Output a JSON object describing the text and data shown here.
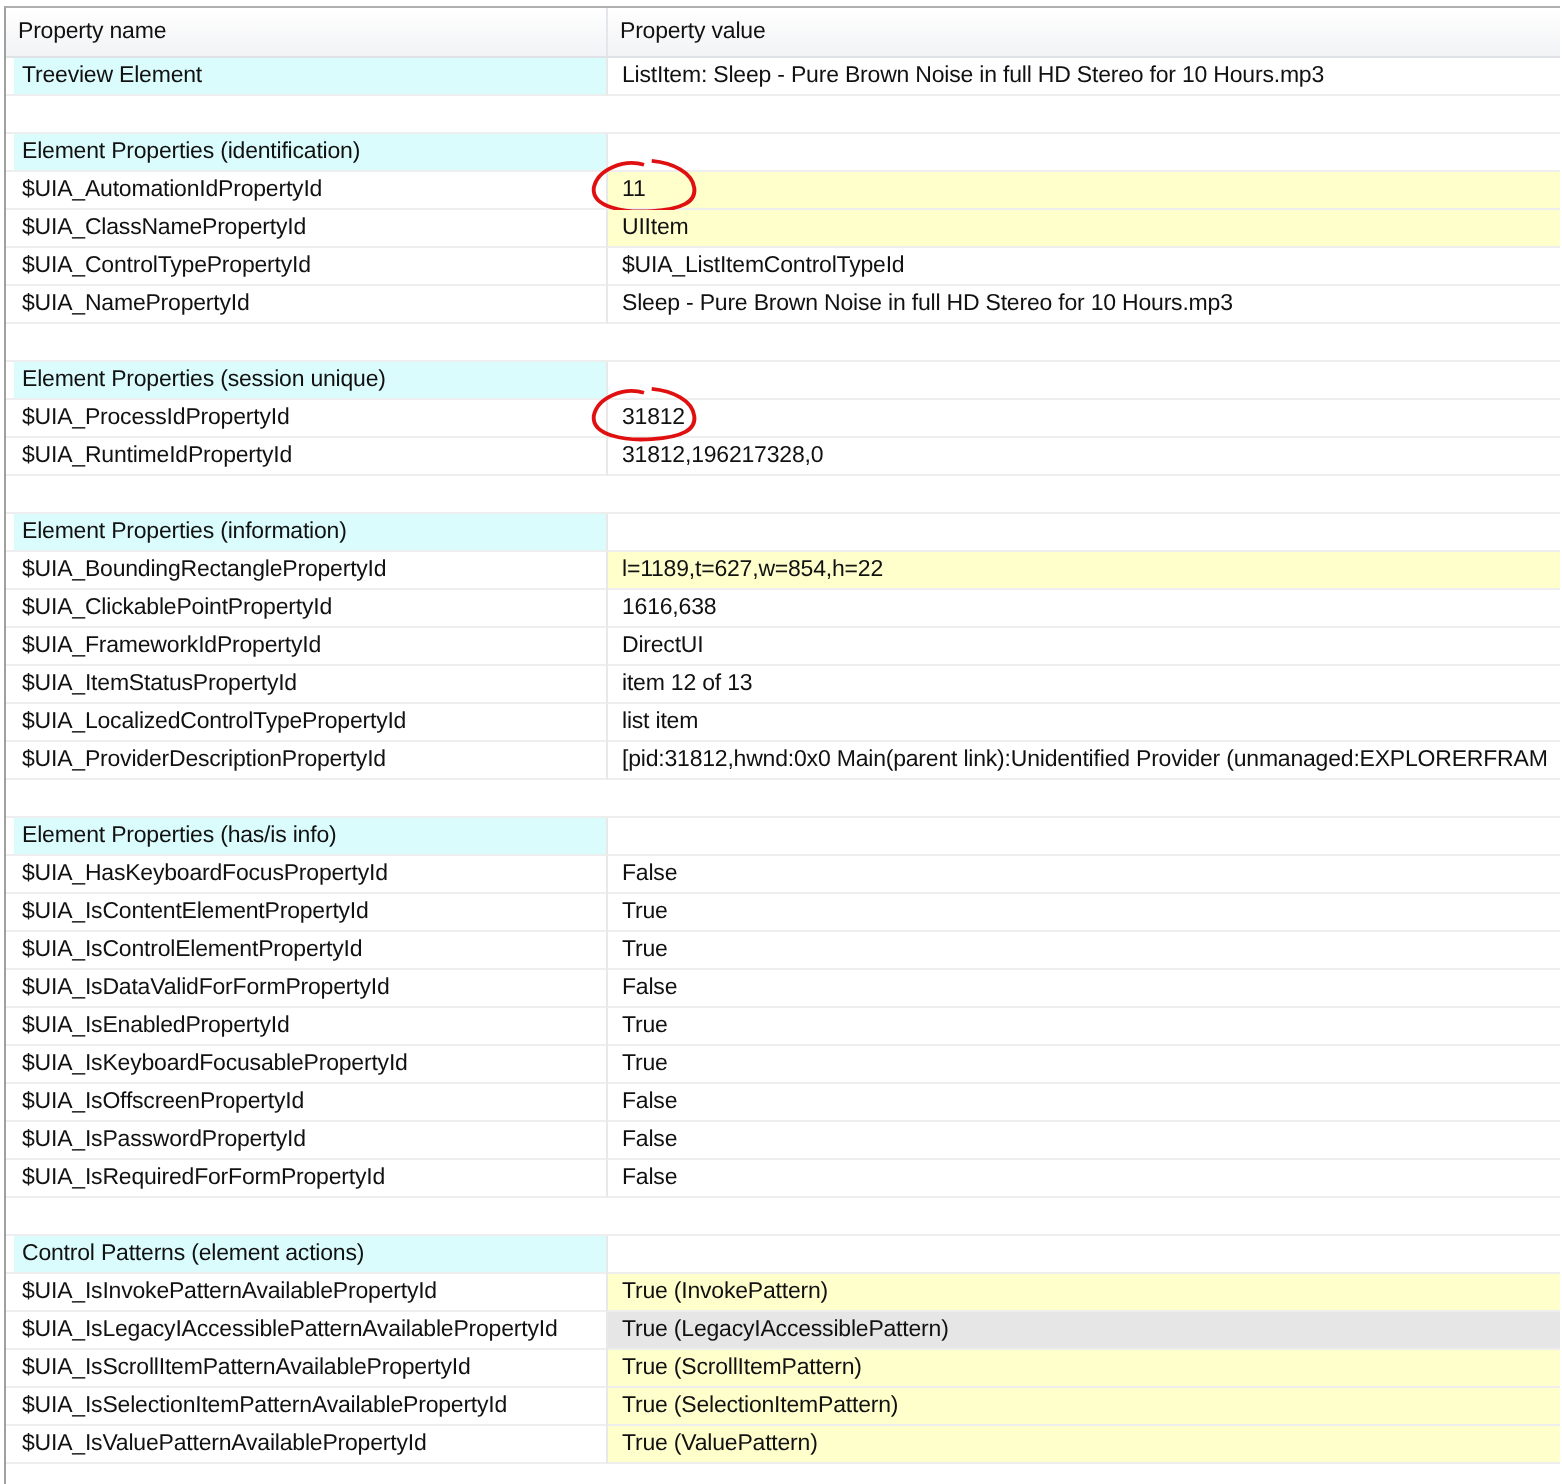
{
  "columns": [
    "Property name",
    "Property value"
  ],
  "rows": [
    {
      "kind": "group",
      "name": "Treeview Element",
      "value": "ListItem: Sleep - Pure Brown Noise in full HD Stereo for 10 Hours.mp3"
    },
    {
      "kind": "blank"
    },
    {
      "kind": "group",
      "name": "Element Properties (identification)"
    },
    {
      "kind": "item",
      "name": "$UIA_AutomationIdPropertyId",
      "value": "11",
      "highlighted": true,
      "selected": false,
      "circled": true
    },
    {
      "kind": "item",
      "name": "$UIA_ClassNamePropertyId",
      "value": "UIItem",
      "highlighted": true,
      "selected": false,
      "circled": false
    },
    {
      "kind": "item",
      "name": "$UIA_ControlTypePropertyId",
      "value": "$UIA_ListItemControlTypeId",
      "highlighted": false,
      "selected": false,
      "circled": false
    },
    {
      "kind": "item",
      "name": "$UIA_NamePropertyId",
      "value": "Sleep - Pure Brown Noise in full HD Stereo for 10 Hours.mp3",
      "highlighted": false,
      "selected": false,
      "circled": false
    },
    {
      "kind": "blank"
    },
    {
      "kind": "group",
      "name": "Element Properties (session unique)"
    },
    {
      "kind": "item",
      "name": "$UIA_ProcessIdPropertyId",
      "value": "31812",
      "highlighted": false,
      "selected": false,
      "circled": true
    },
    {
      "kind": "item",
      "name": "$UIA_RuntimeIdPropertyId",
      "value": "31812,196217328,0",
      "highlighted": false,
      "selected": false,
      "circled": false
    },
    {
      "kind": "blank"
    },
    {
      "kind": "group",
      "name": "Element Properties (information)"
    },
    {
      "kind": "item",
      "name": "$UIA_BoundingRectanglePropertyId",
      "value": "l=1189,t=627,w=854,h=22",
      "highlighted": true,
      "selected": false,
      "circled": false
    },
    {
      "kind": "item",
      "name": "$UIA_ClickablePointPropertyId",
      "value": "1616,638",
      "highlighted": false,
      "selected": false,
      "circled": false
    },
    {
      "kind": "item",
      "name": "$UIA_FrameworkIdPropertyId",
      "value": "DirectUI",
      "highlighted": false,
      "selected": false,
      "circled": false
    },
    {
      "kind": "item",
      "name": "$UIA_ItemStatusPropertyId",
      "value": "item 12 of 13",
      "highlighted": false,
      "selected": false,
      "circled": false
    },
    {
      "kind": "item",
      "name": "$UIA_LocalizedControlTypePropertyId",
      "value": "list item",
      "highlighted": false,
      "selected": false,
      "circled": false
    },
    {
      "kind": "item",
      "name": "$UIA_ProviderDescriptionPropertyId",
      "value": "[pid:31812,hwnd:0x0 Main(parent link):Unidentified Provider (unmanaged:EXPLORERFRAM",
      "highlighted": false,
      "selected": false,
      "circled": false
    },
    {
      "kind": "blank"
    },
    {
      "kind": "group",
      "name": "Element Properties (has/is info)"
    },
    {
      "kind": "item",
      "name": "$UIA_HasKeyboardFocusPropertyId",
      "value": "False",
      "highlighted": false,
      "selected": false,
      "circled": false
    },
    {
      "kind": "item",
      "name": "$UIA_IsContentElementPropertyId",
      "value": "True",
      "highlighted": false,
      "selected": false,
      "circled": false
    },
    {
      "kind": "item",
      "name": "$UIA_IsControlElementPropertyId",
      "value": "True",
      "highlighted": false,
      "selected": false,
      "circled": false
    },
    {
      "kind": "item",
      "name": "$UIA_IsDataValidForFormPropertyId",
      "value": "False",
      "highlighted": false,
      "selected": false,
      "circled": false
    },
    {
      "kind": "item",
      "name": "$UIA_IsEnabledPropertyId",
      "value": "True",
      "highlighted": false,
      "selected": false,
      "circled": false
    },
    {
      "kind": "item",
      "name": "$UIA_IsKeyboardFocusablePropertyId",
      "value": "True",
      "highlighted": false,
      "selected": false,
      "circled": false
    },
    {
      "kind": "item",
      "name": "$UIA_IsOffscreenPropertyId",
      "value": "False",
      "highlighted": false,
      "selected": false,
      "circled": false
    },
    {
      "kind": "item",
      "name": "$UIA_IsPasswordPropertyId",
      "value": "False",
      "highlighted": false,
      "selected": false,
      "circled": false
    },
    {
      "kind": "item",
      "name": "$UIA_IsRequiredForFormPropertyId",
      "value": "False",
      "highlighted": false,
      "selected": false,
      "circled": false
    },
    {
      "kind": "blank"
    },
    {
      "kind": "group",
      "name": "Control Patterns (element actions)"
    },
    {
      "kind": "item",
      "name": "$UIA_IsInvokePatternAvailablePropertyId",
      "value": "True (InvokePattern)",
      "highlighted": true,
      "selected": false,
      "circled": false
    },
    {
      "kind": "item",
      "name": "$UIA_IsLegacyIAccessiblePatternAvailablePropertyId",
      "value": "True (LegacyIAccessiblePattern)",
      "selected": true,
      "circled": false
    },
    {
      "kind": "item",
      "name": "$UIA_IsScrollItemPatternAvailablePropertyId",
      "value": "True (ScrollItemPattern)",
      "highlighted": true,
      "selected": false,
      "circled": false
    },
    {
      "kind": "item",
      "name": "$UIA_IsSelectionItemPatternAvailablePropertyId",
      "value": "True (SelectionItemPattern)",
      "highlighted": true,
      "selected": false,
      "circled": false
    },
    {
      "kind": "item",
      "name": "$UIA_IsValuePatternAvailablePropertyId",
      "value": "True (ValuePattern)",
      "highlighted": true,
      "selected": false,
      "circled": false
    }
  ]
}
